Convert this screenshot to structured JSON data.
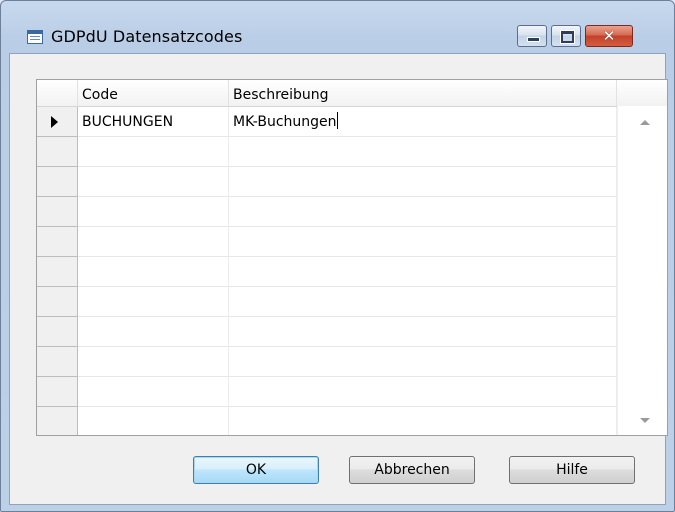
{
  "window": {
    "title": "GDPdU Datensatzcodes",
    "close_glyph": "✕"
  },
  "grid": {
    "columns": [
      "Code",
      "Beschreibung"
    ],
    "rows": [
      {
        "code": "BUCHUNGEN",
        "description": "MK-Buchungen",
        "current": true
      },
      {
        "code": "",
        "description": ""
      },
      {
        "code": "",
        "description": ""
      },
      {
        "code": "",
        "description": ""
      },
      {
        "code": "",
        "description": ""
      },
      {
        "code": "",
        "description": ""
      },
      {
        "code": "",
        "description": ""
      },
      {
        "code": "",
        "description": ""
      },
      {
        "code": "",
        "description": ""
      },
      {
        "code": "",
        "description": ""
      },
      {
        "code": "",
        "description": ""
      }
    ]
  },
  "buttons": {
    "ok": "OK",
    "cancel": "Abbrechen",
    "help": "Hilfe"
  },
  "icons": {
    "app": "table-icon",
    "minimize": "minimize-icon",
    "maximize": "maximize-icon",
    "close": "close-icon",
    "row_indicator": "row-pointer-icon",
    "scroll_up": "scroll-up-icon",
    "scroll_down": "scroll-down-icon"
  },
  "colors": {
    "close_button": "#c2412a",
    "title_bar": "#c7d9ee",
    "dialog_bg": "#f0f0f0"
  }
}
